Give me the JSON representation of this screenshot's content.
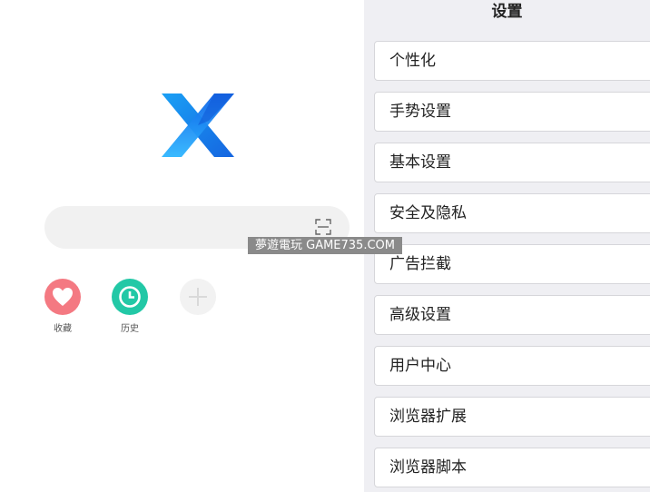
{
  "home": {
    "logo_icon": "x-browser-logo",
    "search": {
      "placeholder": "",
      "scan_icon": "scan-icon"
    },
    "quick_links": [
      {
        "label": "收藏",
        "icon": "heart-icon",
        "color": "#f47982"
      },
      {
        "label": "历史",
        "icon": "clock-icon",
        "color": "#22c8a6"
      },
      {
        "label": "",
        "icon": "plus-icon",
        "color": "#f2f2f2"
      }
    ]
  },
  "settings": {
    "title": "设置",
    "items": [
      {
        "label": "个性化"
      },
      {
        "label": "手势设置"
      },
      {
        "label": "基本设置"
      },
      {
        "label": "安全及隐私"
      },
      {
        "label": "广告拦截"
      },
      {
        "label": "高级设置"
      },
      {
        "label": "用户中心"
      },
      {
        "label": "浏览器扩展"
      },
      {
        "label": "浏览器脚本"
      }
    ]
  },
  "watermark": {
    "text": "夢遊電玩 GAME735.COM"
  }
}
